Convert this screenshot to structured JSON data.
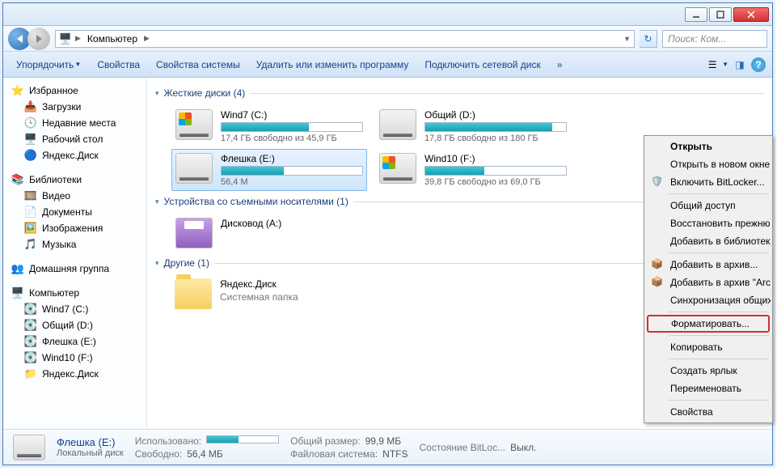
{
  "breadcrumb": {
    "root_icon": "computer",
    "seg1": "Компьютер"
  },
  "search": {
    "placeholder": "Поиск: Ком..."
  },
  "toolbar": {
    "organize": "Упорядочить",
    "properties": "Свойства",
    "sysprops": "Свойства системы",
    "uninstall": "Удалить или изменить программу",
    "mapdrive": "Подключить сетевой диск",
    "more": "»"
  },
  "sidebar": {
    "favorites": {
      "label": "Избранное",
      "items": [
        {
          "icon": "download",
          "label": "Загрузки"
        },
        {
          "icon": "recent",
          "label": "Недавние места"
        },
        {
          "icon": "desktop",
          "label": "Рабочий стол"
        },
        {
          "icon": "yadisk",
          "label": "Яндекс.Диск"
        }
      ]
    },
    "libraries": {
      "label": "Библиотеки",
      "items": [
        {
          "icon": "video",
          "label": "Видео"
        },
        {
          "icon": "docs",
          "label": "Документы"
        },
        {
          "icon": "images",
          "label": "Изображения"
        },
        {
          "icon": "music",
          "label": "Музыка"
        }
      ]
    },
    "homegroup": {
      "label": "Домашняя группа"
    },
    "computer": {
      "label": "Компьютер",
      "items": [
        {
          "label": "Wind7 (C:)"
        },
        {
          "label": "Общий (D:)"
        },
        {
          "label": "Флешка (E:)"
        },
        {
          "label": "Wind10 (F:)"
        },
        {
          "label": "Яндекс.Диск"
        }
      ]
    }
  },
  "content": {
    "hdd_header": "Жесткие диски (4)",
    "removable_header": "Устройства со съемными носителями (1)",
    "other_header": "Другие (1)",
    "drives": [
      {
        "name": "Wind7 (C:)",
        "free": "17,4 ГБ свободно из 45,9 ГБ",
        "fill_pct": 62,
        "icon": "win"
      },
      {
        "name": "Общий (D:)",
        "free": "17,8 ГБ свободно из 180 ГБ",
        "fill_pct": 90,
        "icon": "hdd"
      },
      {
        "name": "Флешка (E:)",
        "free": "56,4 М",
        "fill_pct": 44,
        "icon": "hdd",
        "selected": true
      },
      {
        "name": "Wind10 (F:)",
        "free": "39,8 ГБ свободно из 69,0 ГБ",
        "fill_pct": 42,
        "icon": "win"
      }
    ],
    "floppy": {
      "name": "Дисковод (A:)"
    },
    "yadisk": {
      "name": "Яндекс.Диск",
      "sub": "Системная папка"
    }
  },
  "details": {
    "name": "Флешка (E:)",
    "type": "Локальный диск",
    "used_lbl": "Использовано:",
    "free_lbl": "Свободно:",
    "free_val": "56,4 МБ",
    "total_lbl": "Общий размер:",
    "total_val": "99,9 МБ",
    "fs_lbl": "Файловая система:",
    "fs_val": "NTFS",
    "bitloc_lbl": "Состояние BitLoc...",
    "bitloc_val": "Выкл."
  },
  "context_menu": {
    "open": "Открыть",
    "open_new": "Открыть в новом окне",
    "bitlocker": "Включить BitLocker...",
    "share": "Общий доступ",
    "restore": "Восстановить прежнюю",
    "add_lib": "Добавить в библиотеку",
    "add_arch": "Добавить в архив...",
    "add_arch_name": "Добавить в архив \"Archiv",
    "sync": "Синхронизация общих п",
    "format": "Форматировать...",
    "copy": "Копировать",
    "shortcut": "Создать ярлык",
    "rename": "Переименовать",
    "props": "Свойства"
  }
}
